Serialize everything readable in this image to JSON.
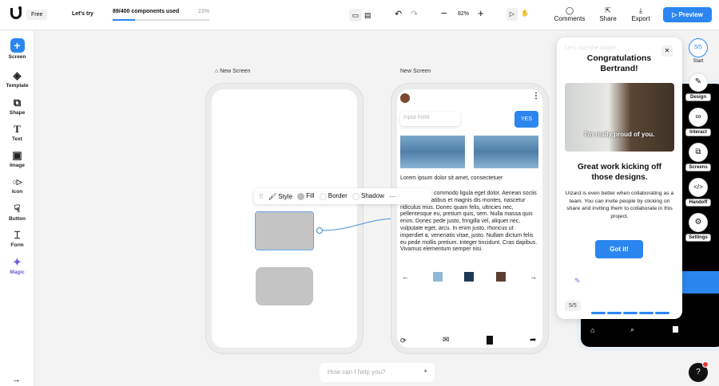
{
  "topbar": {
    "plan": "Free",
    "lets_try": "Let's try",
    "usage": "89/400 components used",
    "usage_pct_label": "23%",
    "usage_fraction": 0.23,
    "zoom": "82%",
    "comments": "Comments",
    "share": "Share",
    "export": "Export",
    "preview": "Preview"
  },
  "sidebar": {
    "items": [
      {
        "label": "Screen",
        "icon": "plus-icon"
      },
      {
        "label": "Template",
        "icon": "layers-icon"
      },
      {
        "label": "Shape",
        "icon": "shape-icon"
      },
      {
        "label": "Text",
        "icon": "text-icon"
      },
      {
        "label": "Image",
        "icon": "image-icon"
      },
      {
        "label": "Icon",
        "icon": "icon-grid-icon"
      },
      {
        "label": "Button",
        "icon": "button-icon"
      },
      {
        "label": "Form",
        "icon": "form-icon"
      },
      {
        "label": "Magic",
        "icon": "sparkle-icon"
      }
    ]
  },
  "canvas": {
    "screen1_label": "New Screen",
    "screen2_label": "New Screen",
    "toolbar": {
      "style": "Style",
      "fill": "Fill",
      "border": "Border",
      "shadow": "Shadow"
    },
    "screen2": {
      "input_placeholder": "Input Field",
      "button": "YES",
      "heading": "Lorem ipsum dolor sit amet, consectetuer",
      "body": "commodo ligula eget dolor. Aenean sociis natoque penatibus et magnis dis montes, nascetur ridiculus mus. Donec quam felis, ultricies nec, pellentesque eu, pretium quis, sem. Nulla massa quis enim. Donec pede justo, fringilla vel, aliquet nec, vulputate eget, arcu. In enim justo, rhoncus ut imperdiet a, venenatis vitae, justo. Nullam dictum felis eu pede mollis pretium. Integer tincidunt. Cras dapibus. Vivamus elementum semper nisi."
    },
    "ai_placeholder": "How can I help you?"
  },
  "tutorial": {
    "faded_title": "Let's start the magic!",
    "title": "Congratulations Bertrand!",
    "gif_caption": "I'm really proud of you.",
    "heading": "Great work kicking off those designs.",
    "body": "Uizard is even better when collaborating as a team. You can invite people by clicking on share and inviting them to collaborate in this project.",
    "button": "Got it!",
    "step": "5/5",
    "progress_fraction": 1.0
  },
  "rail": {
    "step": "5/5",
    "items": [
      "Start",
      "Design",
      "Interact",
      "Screens",
      "Handoff",
      "Settings"
    ]
  },
  "help": "?"
}
